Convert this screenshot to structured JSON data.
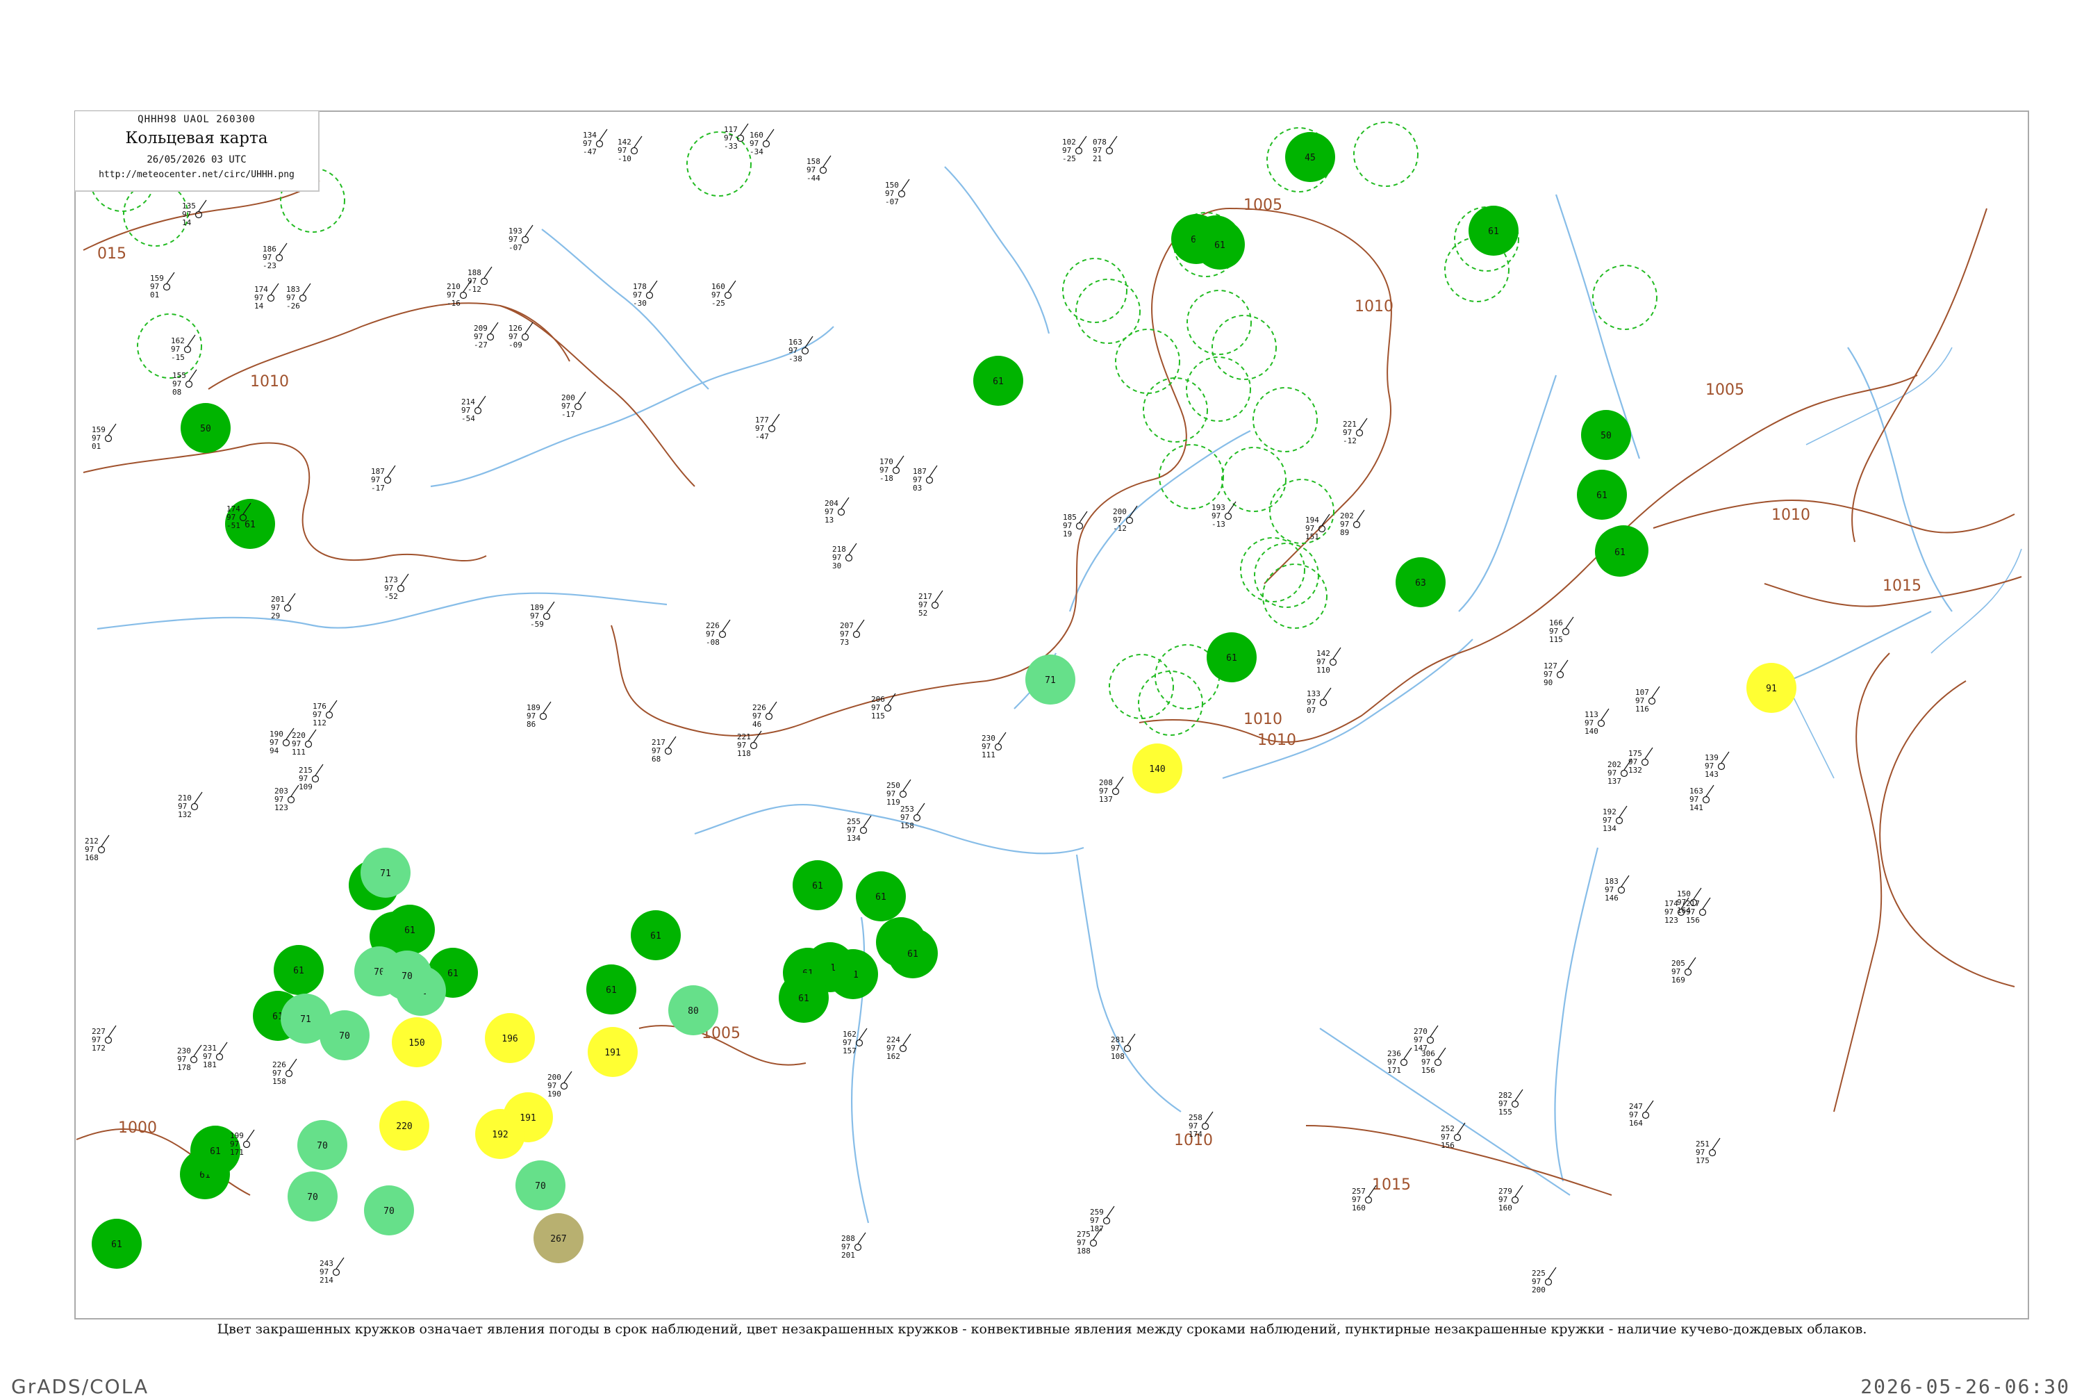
{
  "header": {
    "code_line": "QHHH98  UAOL  260300",
    "title": "Кольцевая карта",
    "date_line": "26/05/2026 03 UTC",
    "url": "http://meteocenter.net/circ/UHHH.png"
  },
  "footnote": "Цвет закрашенных кружков означает явления погоды в срок наблюдений, цвет незакрашенных кружков - конвективные явления между сроками наблюдений, пунктирные незакрашенные кружки - наличие кучево-дождевых облаков.",
  "credit_left": "GrADS/COLA",
  "credit_right": "2026-05-26-06:30",
  "colors": {
    "frame": "#aaaaaa",
    "isobar": "#a0522d",
    "river": "#87bde8",
    "green": "#00b400",
    "light_green": "#66e08a",
    "yellow": "#ffff33",
    "olive": "#b8b070",
    "cb_dashed": "#22bb22",
    "station": "#111111"
  },
  "isobars": [
    {
      "label": "015"
    },
    {
      "label": "1010"
    },
    {
      "label": "1010"
    },
    {
      "label": "1005"
    },
    {
      "label": "1005"
    },
    {
      "label": "1010"
    },
    {
      "label": "1015"
    },
    {
      "label": "1010"
    },
    {
      "label": "1010"
    },
    {
      "label": "1000"
    },
    {
      "label": "1005"
    },
    {
      "label": "1010"
    },
    {
      "label": "1015"
    }
  ],
  "stations": [
    {
      "p": "135",
      "t": "97",
      "d": "14"
    },
    {
      "p": "186",
      "t": "97",
      "d": "-23"
    },
    {
      "p": "174",
      "t": "97",
      "d": "14"
    },
    {
      "p": "159",
      "t": "97",
      "d": "01"
    },
    {
      "p": "162",
      "t": "97",
      "d": "-15"
    },
    {
      "p": "159",
      "t": "97",
      "d": "01"
    },
    {
      "p": "155",
      "t": "97",
      "d": "08"
    },
    {
      "p": "134",
      "t": "97",
      "d": "-47"
    },
    {
      "p": "142",
      "t": "97",
      "d": "-10"
    },
    {
      "p": "117",
      "t": "97",
      "d": "-33"
    },
    {
      "p": "160",
      "t": "97",
      "d": "-34"
    },
    {
      "p": "158",
      "t": "97",
      "d": "-44"
    },
    {
      "p": "150",
      "t": "97",
      "d": "-07"
    },
    {
      "p": "102",
      "t": "97",
      "d": "-25"
    },
    {
      "p": "078",
      "t": "97",
      "d": "21"
    },
    {
      "p": "183",
      "t": "97",
      "d": "-26"
    },
    {
      "p": "210",
      "t": "97",
      "d": "-16"
    },
    {
      "p": "193",
      "t": "97",
      "d": "-07"
    },
    {
      "p": "188",
      "t": "97",
      "d": "-12"
    },
    {
      "p": "209",
      "t": "97",
      "d": "-27"
    },
    {
      "p": "214",
      "t": "97",
      "d": "-54"
    },
    {
      "p": "126",
      "t": "97",
      "d": "-09"
    },
    {
      "p": "200",
      "t": "97",
      "d": "-17"
    },
    {
      "p": "178",
      "t": "97",
      "d": "-30"
    },
    {
      "p": "160",
      "t": "97",
      "d": "-25"
    },
    {
      "p": "163",
      "t": "97",
      "d": "-38"
    },
    {
      "p": "177",
      "t": "97",
      "d": "-47"
    },
    {
      "p": "170",
      "t": "97",
      "d": "-18"
    },
    {
      "p": "187",
      "t": "97",
      "d": "03"
    },
    {
      "p": "204",
      "t": "97",
      "d": "13"
    },
    {
      "p": "218",
      "t": "97",
      "d": "30"
    },
    {
      "p": "185",
      "t": "97",
      "d": "19"
    },
    {
      "p": "200",
      "t": "97",
      "d": "-12"
    },
    {
      "p": "193",
      "t": "97",
      "d": "-13"
    },
    {
      "p": "221",
      "t": "97",
      "d": "-12"
    },
    {
      "p": "202",
      "t": "97",
      "d": "89"
    },
    {
      "p": "194",
      "t": "97",
      "d": "151"
    },
    {
      "p": "174",
      "t": "97",
      "d": "-51"
    },
    {
      "p": "187",
      "t": "97",
      "d": "-17"
    },
    {
      "p": "173",
      "t": "97",
      "d": "-52"
    },
    {
      "p": "201",
      "t": "97",
      "d": "29"
    },
    {
      "p": "189",
      "t": "97",
      "d": "-59"
    },
    {
      "p": "226",
      "t": "97",
      "d": "-08"
    },
    {
      "p": "207",
      "t": "97",
      "d": "73"
    },
    {
      "p": "217",
      "t": "97",
      "d": "52"
    },
    {
      "p": "133",
      "t": "97",
      "d": "07"
    },
    {
      "p": "142",
      "t": "97",
      "d": "110"
    },
    {
      "p": "166",
      "t": "97",
      "d": "115"
    },
    {
      "p": "127",
      "t": "97",
      "d": "90"
    },
    {
      "p": "176",
      "t": "97",
      "d": "112"
    },
    {
      "p": "220",
      "t": "97",
      "d": "111"
    },
    {
      "p": "190",
      "t": "97",
      "d": "94"
    },
    {
      "p": "189",
      "t": "97",
      "d": "86"
    },
    {
      "p": "217",
      "t": "97",
      "d": "68"
    },
    {
      "p": "226",
      "t": "97",
      "d": "46"
    },
    {
      "p": "221",
      "t": "97",
      "d": "118"
    },
    {
      "p": "206",
      "t": "97",
      "d": "115"
    },
    {
      "p": "230",
      "t": "97",
      "d": "111"
    },
    {
      "p": "210",
      "t": "97",
      "d": "132"
    },
    {
      "p": "212",
      "t": "97",
      "d": "168"
    },
    {
      "p": "203",
      "t": "97",
      "d": "123"
    },
    {
      "p": "215",
      "t": "97",
      "d": "109"
    },
    {
      "p": "250",
      "t": "97",
      "d": "119"
    },
    {
      "p": "255",
      "t": "97",
      "d": "134"
    },
    {
      "p": "253",
      "t": "97",
      "d": "158"
    },
    {
      "p": "208",
      "t": "97",
      "d": "137"
    },
    {
      "p": "202",
      "t": "97",
      "d": "137"
    },
    {
      "p": "175",
      "t": "97",
      "d": "132"
    },
    {
      "p": "192",
      "t": "97",
      "d": "134"
    },
    {
      "p": "183",
      "t": "97",
      "d": "146"
    },
    {
      "p": "174",
      "t": "97",
      "d": "123"
    },
    {
      "p": "162",
      "t": "97",
      "d": "157"
    },
    {
      "p": "224",
      "t": "97",
      "d": "162"
    },
    {
      "p": "281",
      "t": "97",
      "d": "108"
    },
    {
      "p": "306",
      "t": "97",
      "d": "156"
    },
    {
      "p": "226",
      "t": "97",
      "d": "158"
    },
    {
      "p": "231",
      "t": "97",
      "d": "181"
    },
    {
      "p": "200",
      "t": "97",
      "d": "190"
    },
    {
      "p": "227",
      "t": "97",
      "d": "172"
    },
    {
      "p": "230",
      "t": "97",
      "d": "178"
    },
    {
      "p": "199",
      "t": "97",
      "d": "171"
    },
    {
      "p": "247",
      "t": "97",
      "d": "164"
    },
    {
      "p": "236",
      "t": "97",
      "d": "171"
    },
    {
      "p": "270",
      "t": "97",
      "d": "147"
    },
    {
      "p": "282",
      "t": "97",
      "d": "155"
    },
    {
      "p": "258",
      "t": "97",
      "d": "174"
    },
    {
      "p": "252",
      "t": "97",
      "d": "156"
    },
    {
      "p": "257",
      "t": "97",
      "d": "160"
    },
    {
      "p": "279",
      "t": "97",
      "d": "160"
    },
    {
      "p": "288",
      "t": "97",
      "d": "201"
    },
    {
      "p": "243",
      "t": "97",
      "d": "214"
    },
    {
      "p": "275",
      "t": "97",
      "d": "188"
    },
    {
      "p": "259",
      "t": "97",
      "d": "187"
    },
    {
      "p": "225",
      "t": "97",
      "d": "200"
    },
    {
      "p": "251",
      "t": "97",
      "d": "175"
    },
    {
      "p": "163",
      "t": "97",
      "d": "141"
    },
    {
      "p": "113",
      "t": "97",
      "d": "140"
    },
    {
      "p": "217",
      "t": "97",
      "d": "156"
    },
    {
      "p": "150",
      "t": "97",
      "d": "164"
    },
    {
      "p": "205",
      "t": "97",
      "d": "169"
    },
    {
      "p": "107",
      "t": "97",
      "d": "116"
    },
    {
      "p": "139",
      "t": "97",
      "d": "143"
    }
  ],
  "filled_circles": [
    {
      "fill": "#00b400",
      "code": "45"
    },
    {
      "fill": "#00b400",
      "code": "50"
    },
    {
      "fill": "#00b400",
      "code": "61"
    },
    {
      "fill": "#00b400",
      "code": "50"
    },
    {
      "fill": "#00b400",
      "code": "61"
    },
    {
      "fill": "#00b400",
      "code": "61"
    },
    {
      "fill": "#00b400",
      "code": "50"
    },
    {
      "fill": "#00b400",
      "code": "61"
    },
    {
      "fill": "#00b400",
      "code": "61"
    },
    {
      "fill": "#00b400",
      "code": "60"
    },
    {
      "fill": "#00b400",
      "code": "61"
    },
    {
      "fill": "#00b400",
      "code": "63"
    },
    {
      "fill": "#00b400",
      "code": "61"
    },
    {
      "fill": "#00b400",
      "code": "61"
    },
    {
      "fill": "#00b400",
      "code": "61"
    },
    {
      "fill": "#00b400",
      "code": "61"
    },
    {
      "fill": "#00b400",
      "code": "61"
    },
    {
      "fill": "#00b400",
      "code": "61"
    },
    {
      "fill": "#00b400",
      "code": "61"
    },
    {
      "fill": "#00b400",
      "code": "61"
    },
    {
      "fill": "#00b400",
      "code": "61"
    },
    {
      "fill": "#00b400",
      "code": "61"
    },
    {
      "fill": "#00b400",
      "code": "61"
    },
    {
      "fill": "#00b400",
      "code": "61"
    },
    {
      "fill": "#00b400",
      "code": "61"
    },
    {
      "fill": "#00b400",
      "code": "61"
    },
    {
      "fill": "#00b400",
      "code": "61"
    },
    {
      "fill": "#00b400",
      "code": "61"
    },
    {
      "fill": "#00b400",
      "code": "61"
    },
    {
      "fill": "#00b400",
      "code": "61"
    },
    {
      "fill": "#00b400",
      "code": "61"
    },
    {
      "fill": "#00b400",
      "code": "61"
    },
    {
      "fill": "#00b400",
      "code": "61"
    },
    {
      "fill": "#66e08a",
      "code": "71"
    },
    {
      "fill": "#66e08a",
      "code": "71"
    },
    {
      "fill": "#66e08a",
      "code": "70"
    },
    {
      "fill": "#66e08a",
      "code": "70"
    },
    {
      "fill": "#66e08a",
      "code": "80"
    },
    {
      "fill": "#66e08a",
      "code": "71"
    },
    {
      "fill": "#66e08a",
      "code": "71"
    },
    {
      "fill": "#66e08a",
      "code": "70"
    },
    {
      "fill": "#66e08a",
      "code": "70"
    },
    {
      "fill": "#66e08a",
      "code": "70"
    },
    {
      "fill": "#66e08a",
      "code": "70"
    },
    {
      "fill": "#66e08a",
      "code": "70"
    },
    {
      "fill": "#ffff33",
      "code": "91"
    },
    {
      "fill": "#ffff33",
      "code": "140"
    },
    {
      "fill": "#ffff33",
      "code": "150"
    },
    {
      "fill": "#ffff33",
      "code": "196"
    },
    {
      "fill": "#ffff33",
      "code": "191"
    },
    {
      "fill": "#ffff33",
      "code": "191"
    },
    {
      "fill": "#ffff33",
      "code": "192"
    },
    {
      "fill": "#ffff33",
      "code": "220"
    },
    {
      "fill": "#b8b070",
      "code": "267"
    }
  ],
  "dashed_circles": [
    {
      "code": "CB"
    },
    {
      "code": "CB"
    },
    {
      "code": "CB"
    },
    {
      "code": "CB"
    },
    {
      "code": "CB"
    },
    {
      "code": "CB"
    },
    {
      "code": "CB"
    },
    {
      "code": "CB"
    },
    {
      "code": "CB"
    },
    {
      "code": "CB"
    },
    {
      "code": "CB"
    },
    {
      "code": "CB"
    },
    {
      "code": "CB"
    },
    {
      "code": "CB"
    },
    {
      "code": "CB"
    },
    {
      "code": "CB"
    },
    {
      "code": "CB"
    },
    {
      "code": "CB"
    },
    {
      "code": "CB"
    },
    {
      "code": "CB"
    },
    {
      "code": "CB"
    },
    {
      "code": "CB"
    },
    {
      "code": "CB"
    },
    {
      "code": "CB"
    },
    {
      "code": "CB"
    },
    {
      "code": "CB"
    },
    {
      "code": "CB"
    },
    {
      "code": "CB"
    }
  ]
}
